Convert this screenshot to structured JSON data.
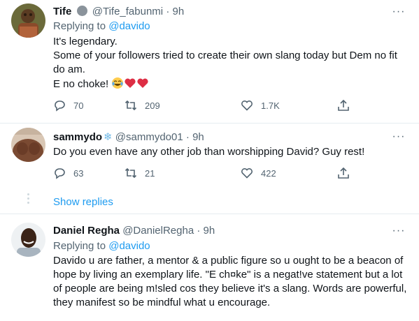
{
  "tweets": [
    {
      "name": "Tife",
      "badge_icon": "verified-gray-circle-icon",
      "handle": "@Tife_fabunmi",
      "dot": "·",
      "time": "9h",
      "replying_prefix": "Replying to",
      "replying_to": "@davido",
      "lines": [
        "It's legendary.",
        "Some of your followers tried to create their own slang today but Dem no fit",
        "do am.",
        "E no choke!"
      ],
      "emojis": [
        "face-with-tears-of-joy-icon",
        "red-heart-icon",
        "red-heart-icon"
      ],
      "replies": "70",
      "retweets": "209",
      "likes": "1.7K"
    },
    {
      "name": "sammydo",
      "name_suffix_icon": "snowflake-icon",
      "handle": "@sammydo01",
      "dot": "·",
      "time": "9h",
      "lines": [
        "Do you even have any other job than worshipping David? Guy rest!"
      ],
      "replies": "63",
      "retweets": "21",
      "likes": "422"
    },
    {
      "name": "Daniel Regha",
      "handle": "@DanielRegha",
      "dot": "·",
      "time": "9h",
      "replying_prefix": "Replying to",
      "replying_to": "@davido",
      "lines": [
        "Davido u are father, a mentor & a public figure so u ought to be a beacon of",
        "hope by living an exemplary life. \"E ch¤ke\" is a negat!ve statement but a lot",
        "of people are being m!sled cos they believe it's a slang. Words are powerful,",
        "they manifest so be mindful what u encourage."
      ]
    }
  ],
  "show_replies_label": "Show replies",
  "more_label": "···",
  "colors": {
    "accent": "#1d9bf0",
    "secondary_text": "#536471",
    "like_heart": "#e0245e"
  }
}
